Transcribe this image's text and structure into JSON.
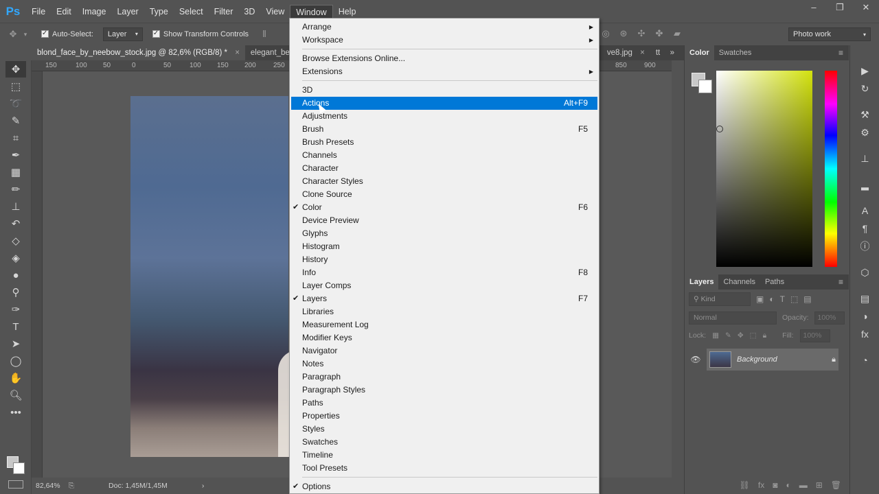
{
  "menubar": {
    "logo": "Ps",
    "items": [
      "File",
      "Edit",
      "Image",
      "Layer",
      "Type",
      "Select",
      "Filter",
      "3D",
      "View",
      "Window",
      "Help"
    ],
    "active": "Window"
  },
  "window_controls": {
    "minimize": "–",
    "restore": "❐",
    "close": "✕"
  },
  "options": {
    "auto_select": "Auto-Select:",
    "layer_dropdown": "Layer",
    "show_transform": "Show Transform Controls",
    "workspace": "Photo work"
  },
  "tabs": [
    {
      "label": "blond_face_by_neebow_stock.jpg @ 82,6% (RGB/8) *",
      "close": "×"
    },
    {
      "label": "elegant_be",
      "close": ""
    },
    {
      "label": "ve8.jpg",
      "close": "×"
    },
    {
      "label": "tt",
      "close": ""
    }
  ],
  "tab_overflow": "»",
  "ruler": {
    "ticks": [
      "150",
      "100",
      "50",
      "0",
      "50",
      "100",
      "150",
      "200",
      "250",
      "850",
      "900"
    ]
  },
  "status": {
    "zoom": "82,64%",
    "doc": "Doc: 1,45M/1,45M",
    "arrow": "›"
  },
  "panels": {
    "color_tabs": [
      "Color",
      "Swatches"
    ],
    "layers_tabs": [
      "Layers",
      "Channels",
      "Paths"
    ],
    "kind": "Kind",
    "blend": "Normal",
    "opacity_label": "Opacity:",
    "opacity": "100%",
    "lock_label": "Lock:",
    "fill_label": "Fill:",
    "fill": "100%",
    "layer_name": "Background"
  },
  "window_menu": {
    "groups": [
      [
        {
          "label": "Arrange",
          "submenu": true
        },
        {
          "label": "Workspace",
          "submenu": true
        }
      ],
      [
        {
          "label": "Browse Extensions Online..."
        },
        {
          "label": "Extensions",
          "submenu": true
        }
      ],
      [
        {
          "label": "3D"
        },
        {
          "label": "Actions",
          "shortcut": "Alt+F9",
          "highlighted": true
        },
        {
          "label": "Adjustments"
        },
        {
          "label": "Brush",
          "shortcut": "F5"
        },
        {
          "label": "Brush Presets"
        },
        {
          "label": "Channels"
        },
        {
          "label": "Character"
        },
        {
          "label": "Character Styles"
        },
        {
          "label": "Clone Source"
        },
        {
          "label": "Color",
          "shortcut": "F6",
          "checked": true
        },
        {
          "label": "Device Preview"
        },
        {
          "label": "Glyphs"
        },
        {
          "label": "Histogram"
        },
        {
          "label": "History"
        },
        {
          "label": "Info",
          "shortcut": "F8"
        },
        {
          "label": "Layer Comps"
        },
        {
          "label": "Layers",
          "shortcut": "F7",
          "checked": true
        },
        {
          "label": "Libraries"
        },
        {
          "label": "Measurement Log"
        },
        {
          "label": "Modifier Keys"
        },
        {
          "label": "Navigator"
        },
        {
          "label": "Notes"
        },
        {
          "label": "Paragraph"
        },
        {
          "label": "Paragraph Styles"
        },
        {
          "label": "Paths"
        },
        {
          "label": "Properties"
        },
        {
          "label": "Styles"
        },
        {
          "label": "Swatches"
        },
        {
          "label": "Timeline"
        },
        {
          "label": "Tool Presets"
        }
      ],
      [
        {
          "label": "Options",
          "checked": true
        }
      ]
    ]
  },
  "colors": {
    "accent": "#0078d7",
    "ps_blue": "#31a8ff",
    "ui_gray": "#535353"
  }
}
